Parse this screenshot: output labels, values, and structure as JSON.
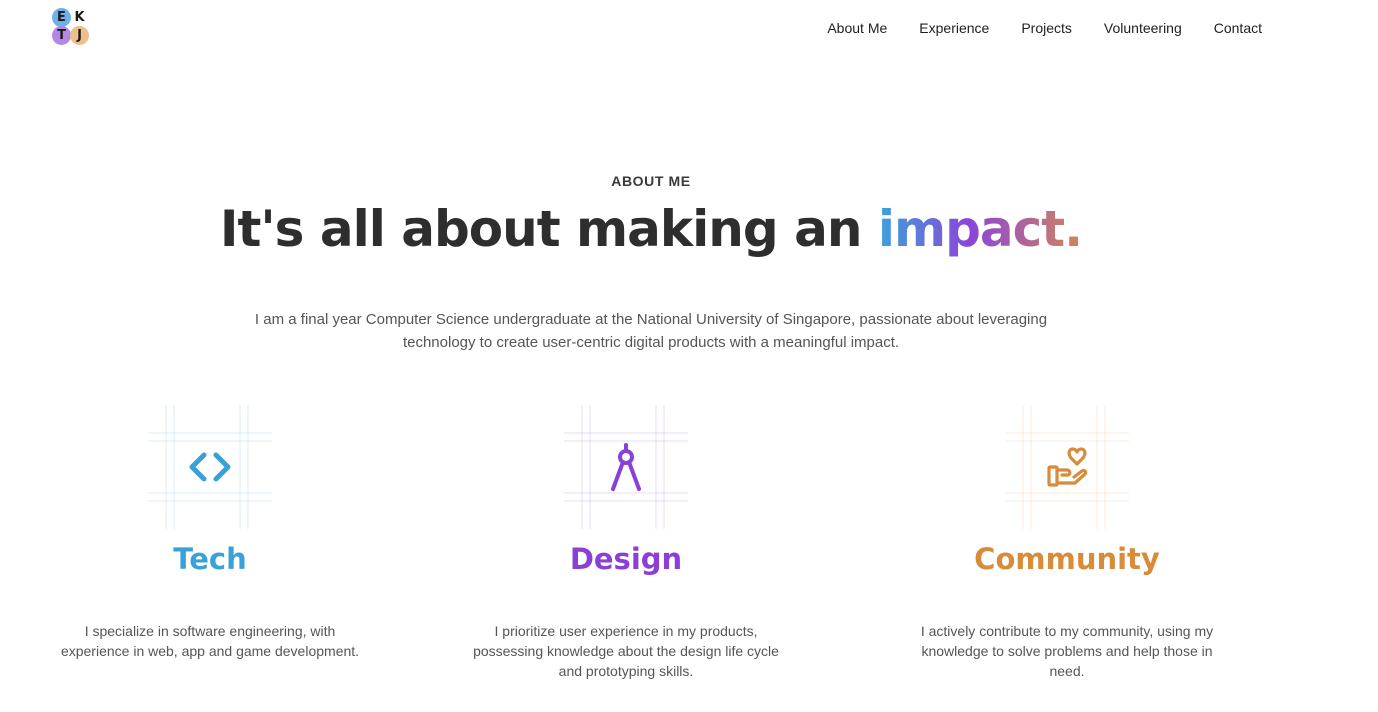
{
  "logo": {
    "letters": [
      "E",
      "K",
      "T",
      "J"
    ]
  },
  "nav": {
    "items": [
      "About Me",
      "Experience",
      "Projects",
      "Volunteering",
      "Contact"
    ]
  },
  "hero": {
    "eyebrow": "ABOUT ME",
    "headline_prefix": "It's all about making an ",
    "headline_accent": "impact.",
    "intro_line1": "I am a final year Computer Science undergraduate at the National University of Singapore, passionate about leveraging",
    "intro_line2": "technology to create user-centric digital products with a meaningful impact."
  },
  "pillars": [
    {
      "icon": "code-brackets-icon",
      "title": "Tech",
      "color": "#3aa0d8",
      "description": "I specialize in software engineering, with experience in web, app and game development."
    },
    {
      "icon": "compass-icon",
      "title": "Design",
      "color": "#8a3fd6",
      "description": "I prioritize user experience in my products, possessing knowledge about the design life cycle and prototyping skills."
    },
    {
      "icon": "heart-hand-icon",
      "title": "Community",
      "color": "#d88b38",
      "description": "I actively contribute to my community, using my knowledge to solve problems and help those in need."
    }
  ]
}
